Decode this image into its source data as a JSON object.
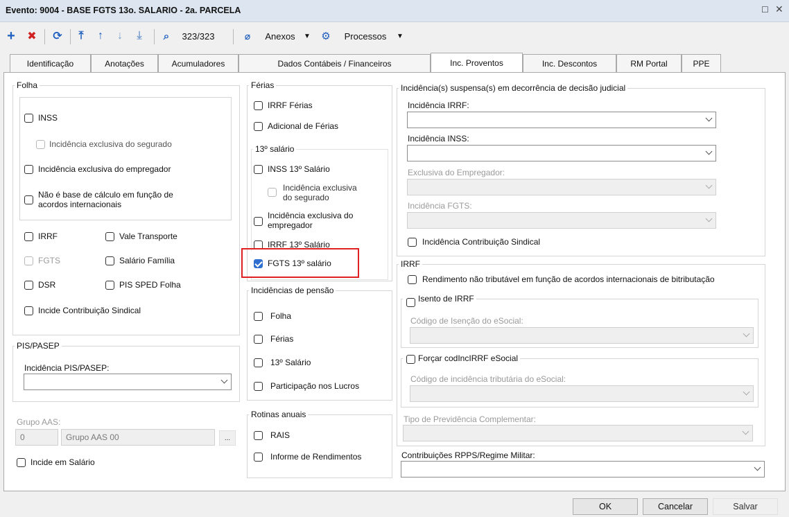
{
  "window": {
    "title": "Evento: 9004 - BASE FGTS 13o. SALARIO - 2a. PARCELA"
  },
  "toolbar": {
    "record_counter": "323/323",
    "anexos": "Anexos",
    "processos": "Processos"
  },
  "tabs": [
    "Identificação",
    "Anotações",
    "Acumuladores",
    "Dados Contábeis / Financeiros",
    "Inc. Proventos",
    "Inc. Descontos",
    "RM Portal",
    "PPE"
  ],
  "folha": {
    "legend": "Folha",
    "inss": "INSS",
    "inss_exclusiva_segurado": "Incidência exclusiva do segurado",
    "inss_exclusiva_empregador": "Incidência exclusiva do empregador",
    "nao_base_line1": "Não é base de cálculo em função de",
    "nao_base_line2": "acordos internacionais",
    "irrf": "IRRF",
    "vale_transporte": "Vale Transporte",
    "fgts": "FGTS",
    "salario_familia": "Salário Família",
    "dsr": "DSR",
    "pis_sped": "PIS SPED Folha",
    "contrib_sindical": "Incide Contribuição Sindical"
  },
  "pis": {
    "legend": "PIS/PASEP",
    "label": "Incidência PIS/PASEP:"
  },
  "grupo_aas": {
    "label": "Grupo AAS:",
    "code": "0",
    "name": "Grupo AAS 00",
    "button": "...",
    "incide_salario": "Incide em Salário"
  },
  "ferias": {
    "legend": "Férias",
    "irrf": "IRRF Férias",
    "adicional": "Adicional de Férias"
  },
  "decimo": {
    "legend": "13º salário",
    "inss": "INSS 13º Salário",
    "excl_segurado_line1": "Incidência exclusiva",
    "excl_segurado_line2": "do segurado",
    "excl_empregador_line1": "Incidência exclusiva do",
    "excl_empregador_line2": "empregador",
    "irrf": "IRRF 13º Salário",
    "fgts": "FGTS 13º salário",
    "fgts_checked": true
  },
  "pensao": {
    "legend": "Incidências de pensão",
    "folha": "Folha",
    "ferias": "Férias",
    "decimo": "13º Salário",
    "lucros": "Participação nos Lucros"
  },
  "rotinas": {
    "legend": "Rotinas anuais",
    "rais": "RAIS",
    "informe": "Informe de Rendimentos"
  },
  "judicial": {
    "legend": "Incidência(s) suspensa(s) em decorrência de decisão judicial",
    "irrf_label": "Incidência IRRF:",
    "inss_label": "Incidência INSS:",
    "empregador_label": "Exclusiva do Empregador:",
    "fgts_label": "Incidência FGTS:",
    "contrib_sindical": "Incidência Contribuição Sindical"
  },
  "irrf_group": {
    "legend": "IRRF",
    "rendimento": "Rendimento não tributável em função de acordos internacionais de bitributação",
    "isento": "Isento de IRRF",
    "codigo_isencao": "Código de Isenção do eSocial:",
    "forcar": "Forçar codIncIRRF eSocial",
    "codigo_incidencia": "Código de incidência tributária do eSocial:"
  },
  "previdencia_label": "Tipo de Previdência Complementar:",
  "rpps_label": "Contribuições RPPS/Regime Militar:",
  "buttons": {
    "ok": "OK",
    "cancelar": "Cancelar",
    "salvar": "Salvar"
  },
  "colors": {
    "accent": "#2f6fcf",
    "highlight": "#e02020",
    "titlebar": "#dde6f0"
  }
}
